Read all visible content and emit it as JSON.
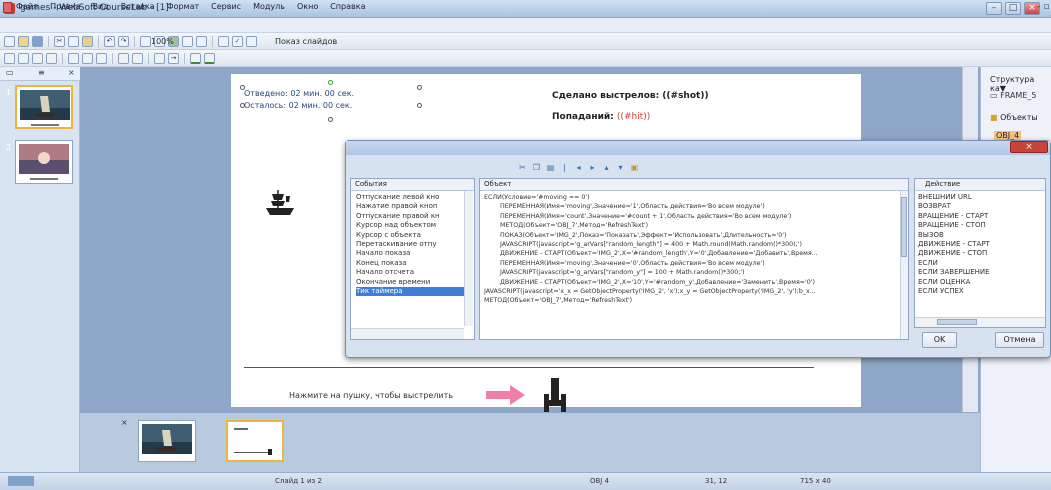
{
  "window": {
    "title": "games - WebSoft CourseLab - [1]"
  },
  "menu": {
    "items": [
      "Файл",
      "Правка",
      "Вид",
      "Вставка",
      "Формат",
      "Сервис",
      "Модуль",
      "Окно",
      "Справка"
    ]
  },
  "toolbar": {
    "zoom": "100%",
    "slideshow_label": "Показ слайдов"
  },
  "slide_panel": {
    "slide_numbers": [
      "1",
      "2"
    ]
  },
  "slide": {
    "timer_elapsed": "Отведено: 02 мин. 00 сек.",
    "timer_remaining": "Осталось: 02 мин. 00 сек.",
    "shots_title": "Сделано выстрелов: ((#shot))",
    "hits_label": "Попаданий:",
    "hits_var": "((#hit))",
    "prompt": "Нажмите на пушку, чтобы выстрелить"
  },
  "structure_panel": {
    "title": "Структура ка▼",
    "frame": "FRAME_5",
    "objects": "Объекты",
    "object1": "OBJ_4"
  },
  "statusbar": {
    "slide": "Слайд 1 из 2",
    "object": "OBJ 4",
    "position": "31, 12",
    "size": "715 x 40"
  },
  "dialog": {
    "events_header": "События",
    "events": [
      "Отпускание левой кно",
      "Нажатие правой кноп",
      "Отпускание правой кн",
      "Курсор над объектом",
      "Курсор с объекта",
      "Перетаскивание отпу",
      "Начало показа",
      "Конец показа",
      "Начало отсчета",
      "Окончание времени",
      "Тик таймера"
    ],
    "selected_event": 10,
    "actions_header": "Объект",
    "actions": [
      {
        "text": "ЕСЛИ(Условие='#moving == 0')",
        "indent": 0
      },
      {
        "text": "ПЕРЕМЕННАЯ(Имя='moving',Значение='1',Область действия='Во всем модуле')",
        "indent": 1
      },
      {
        "text": "ПЕРЕМЕННАЯ(Имя='count',Значение='#count + 1',Область действия='Во всем модуле')",
        "indent": 1
      },
      {
        "text": "МЕТОД(Объект='OBJ_7',Метод='RefreshText')",
        "indent": 1
      },
      {
        "text": "ПОКАЗ(Объект='IMG_2',Показ='Показать',Эффект='Использовать',Длительность='0')",
        "indent": 1
      },
      {
        "text": "JAVASCRIPT(javascript='g_arVars[\"random_length\"] = 400 + Math.round(Math.random()*300);')",
        "indent": 1
      },
      {
        "text": "ДВИЖЕНИЕ - СТАРТ(Объект='IMG_2',X='#random_length',Y='0',Добавление='Добавить',Время...",
        "indent": 1
      },
      {
        "text": "ПЕРЕМЕННАЯ(Имя='moving',Значение='0',Область действия='Во всем модуле')",
        "indent": 1
      },
      {
        "text": "JAVASCRIPT(javascript='g_arVars[\"random_y\"] = 100 + Math.random()*300;')",
        "indent": 1
      },
      {
        "text": "ДВИЖЕНИЕ - СТАРТ(Объект='IMG_2',X='10',Y='#random_y',Добавление='Заменить',Время='0')",
        "indent": 1
      },
      {
        "text": "JAVASCRIPT(javascript='x_x = GetObjectProperty('IMG_2', 'x');x_y = GetObjectProperty('IMG_2', 'y');b_x...",
        "indent": 0
      },
      {
        "text": "МЕТОД(Объект='OBJ_7',Метод='RefreshText')",
        "indent": 0
      }
    ],
    "do_header": "Действие",
    "do_items": [
      "ВНЕШНИЙ URL",
      "ВОЗВРАТ",
      "ВРАЩЕНИЕ - СТАРТ",
      "ВРАЩЕНИЕ - СТОП",
      "ВЫЗОВ",
      "ДВИЖЕНИЕ - СТАРТ",
      "ДВИЖЕНИЕ - СТОП",
      "ЕСЛИ",
      "ЕСЛИ ЗАВЕРШЕНИЕ",
      "ЕСЛИ ОЦЕНКА",
      "ЕСЛИ УСПЕХ"
    ],
    "ok": "OK",
    "cancel": "Отмена"
  }
}
